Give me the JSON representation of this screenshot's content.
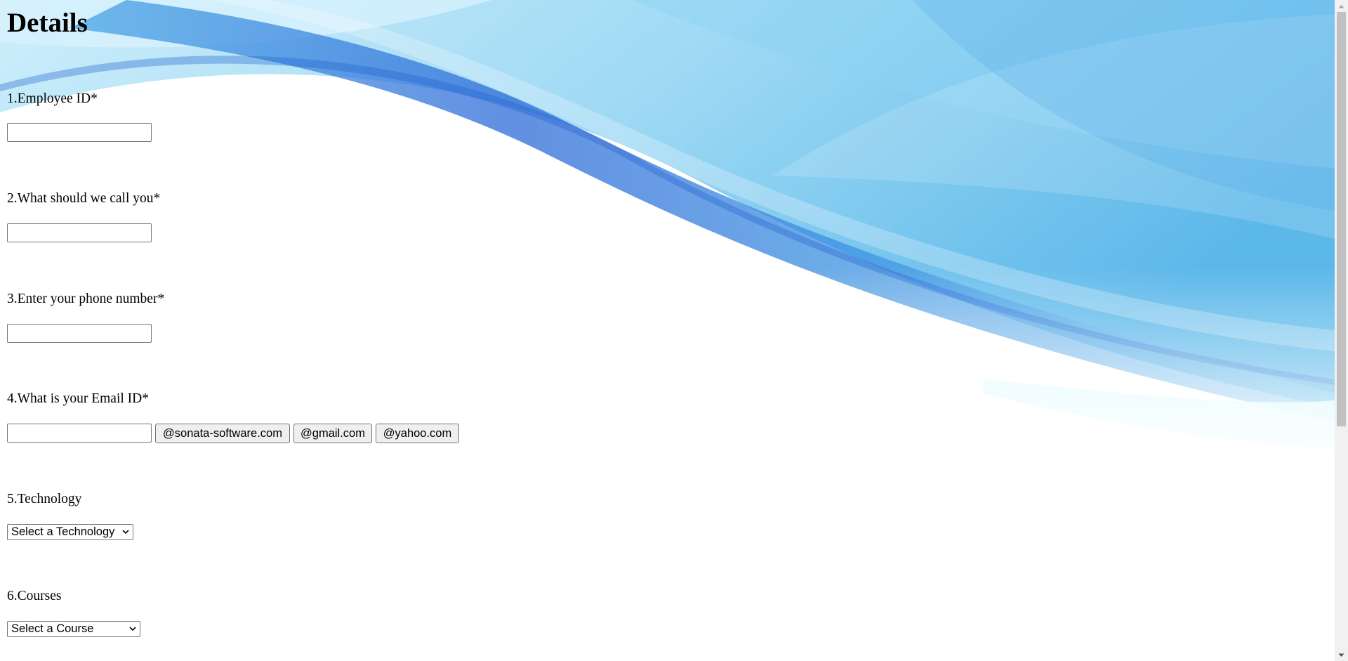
{
  "page": {
    "title": "Details"
  },
  "form": {
    "employee_id": {
      "label": "1.Employee ID*",
      "value": "",
      "placeholder": ""
    },
    "nickname": {
      "label": "2.What should we call you*",
      "value": "",
      "placeholder": ""
    },
    "phone": {
      "label": "3.Enter your phone number*",
      "value": "",
      "placeholder": ""
    },
    "email": {
      "label": "4.What is your Email ID*",
      "value": "",
      "placeholder": "",
      "domain_buttons": [
        "@sonata-software.com",
        "@gmail.com",
        "@yahoo.com"
      ]
    },
    "technology": {
      "label": "5.Technology",
      "selected": "Select a Technology"
    },
    "courses": {
      "label": "6.Courses",
      "selected": "Select a Course"
    }
  },
  "icons": {
    "select_arrow": "chevron-down-icon",
    "scroll_up": "scroll-up-arrow-icon",
    "scroll_down": "scroll-down-arrow-icon"
  },
  "colors": {
    "wave_deep": "#2f6fd6",
    "wave_mid": "#5cb8ec",
    "wave_light": "#bde6f8",
    "wave_cyan": "#dffbff",
    "button_bg": "#efefef",
    "border": "#767676"
  }
}
